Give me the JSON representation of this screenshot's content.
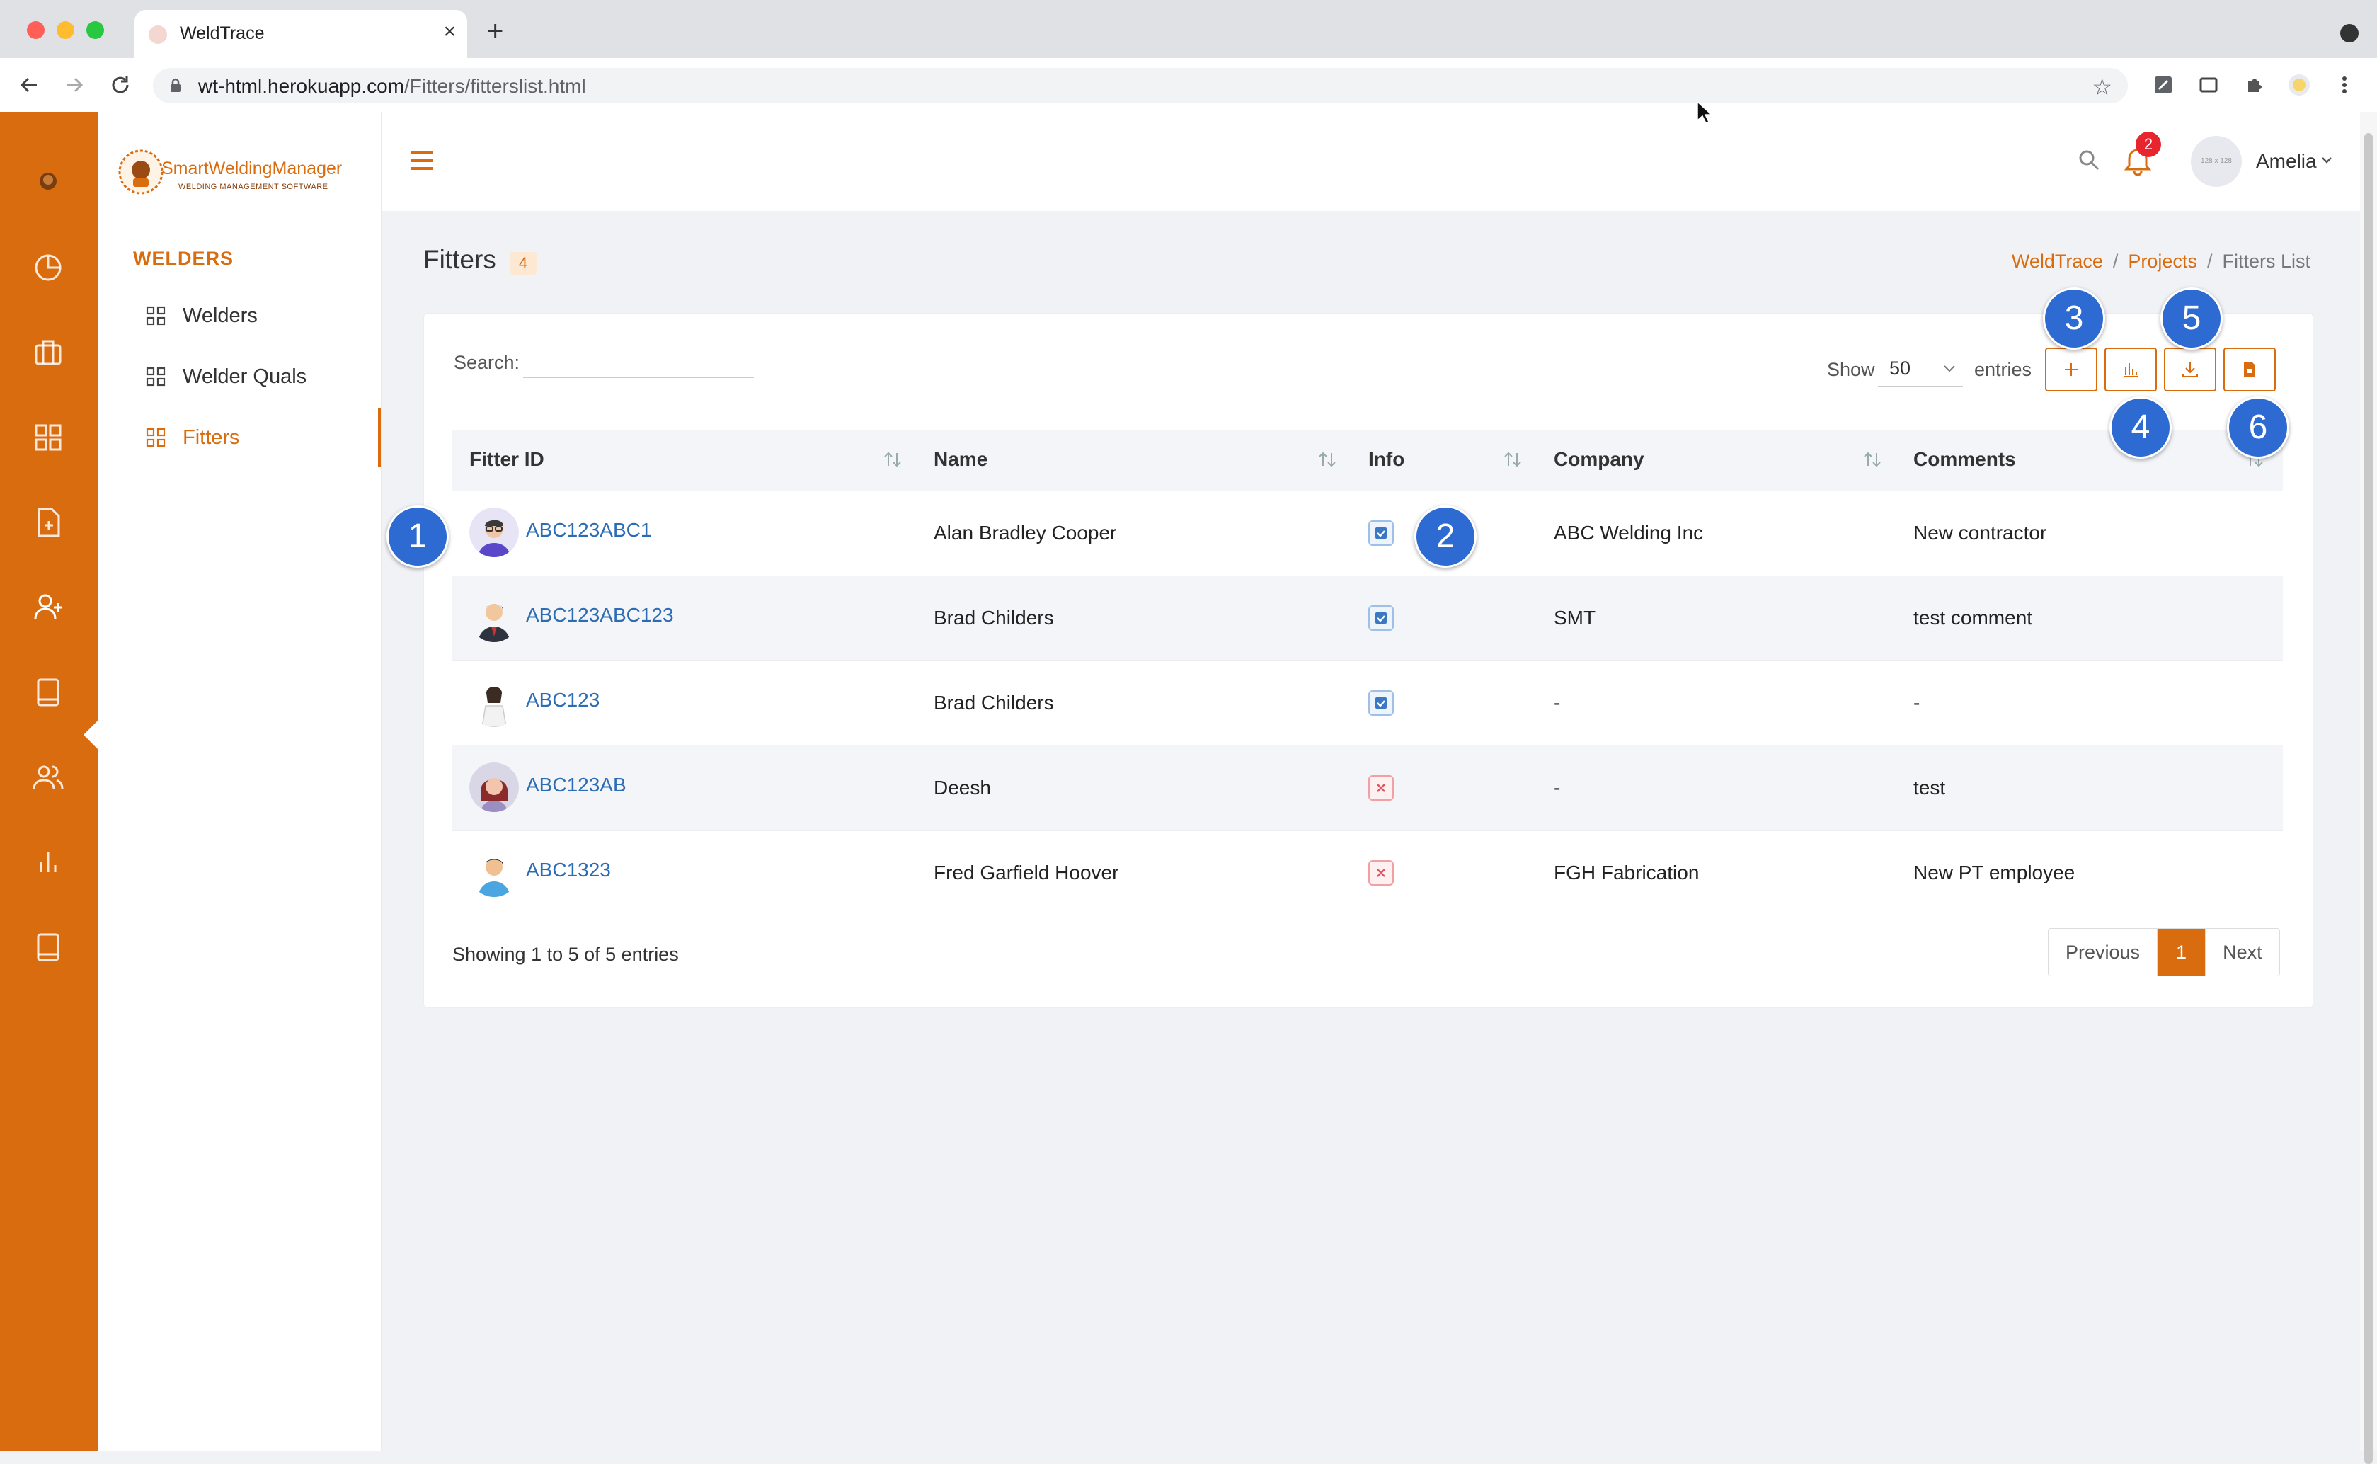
{
  "browser": {
    "tab_title": "WeldTrace",
    "url_host": "wt-html.herokuapp.com",
    "url_path": "/Fitters/fitterslist.html"
  },
  "app": {
    "brand": "SmartWeldingManager",
    "brand_tagline": "WELDING MANAGEMENT SOFTWARE",
    "accent_color": "#d96c0f"
  },
  "sidebar": {
    "heading": "WELDERS",
    "items": [
      {
        "label": "Welders",
        "icon": "grid-icon"
      },
      {
        "label": "Welder Quals",
        "icon": "grid-icon"
      },
      {
        "label": "Fitters",
        "icon": "grid-icon",
        "active": true
      }
    ]
  },
  "rail": {
    "icons": [
      "logo-icon",
      "pie-chart-icon",
      "briefcase-icon",
      "dashboard-grid-icon",
      "document-add-icon",
      "user-add-icon",
      "book-icon",
      "users-icon",
      "bar-chart-icon",
      "book-icon"
    ]
  },
  "topbar": {
    "notification_count": "2",
    "avatar_placeholder": "128 x 128",
    "user_name": "Amelia"
  },
  "page": {
    "title": "Fitters",
    "count": "4",
    "breadcrumb": [
      "WeldTrace",
      "Projects",
      "Fitters List"
    ]
  },
  "table_controls": {
    "search_label": "Search:",
    "show_label": "Show",
    "entries_value": "50",
    "entries_label": "entries"
  },
  "table": {
    "columns": [
      "Fitter ID",
      "Name",
      "Info",
      "Company",
      "Comments"
    ],
    "rows": [
      {
        "id": "ABC123ABC1",
        "name": "Alan Bradley Cooper",
        "info": true,
        "company": "ABC Welding Inc",
        "comments": "New contractor"
      },
      {
        "id": "ABC123ABC123",
        "name": "Brad Childers",
        "info": true,
        "company": "SMT",
        "comments": "test comment"
      },
      {
        "id": "ABC123",
        "name": "Brad Childers",
        "info": true,
        "company": "-",
        "comments": "-"
      },
      {
        "id": "ABC123AB",
        "name": "Deesh",
        "info": false,
        "company": "-",
        "comments": "test"
      },
      {
        "id": "ABC1323",
        "name": "Fred Garfield Hoover",
        "info": false,
        "company": "FGH Fabrication",
        "comments": "New PT employee"
      }
    ],
    "summary": "Showing 1 to 5 of 5 entries"
  },
  "pagination": {
    "previous": "Previous",
    "current": "1",
    "next": "Next"
  },
  "annotations": [
    "1",
    "2",
    "3",
    "4",
    "5",
    "6"
  ]
}
